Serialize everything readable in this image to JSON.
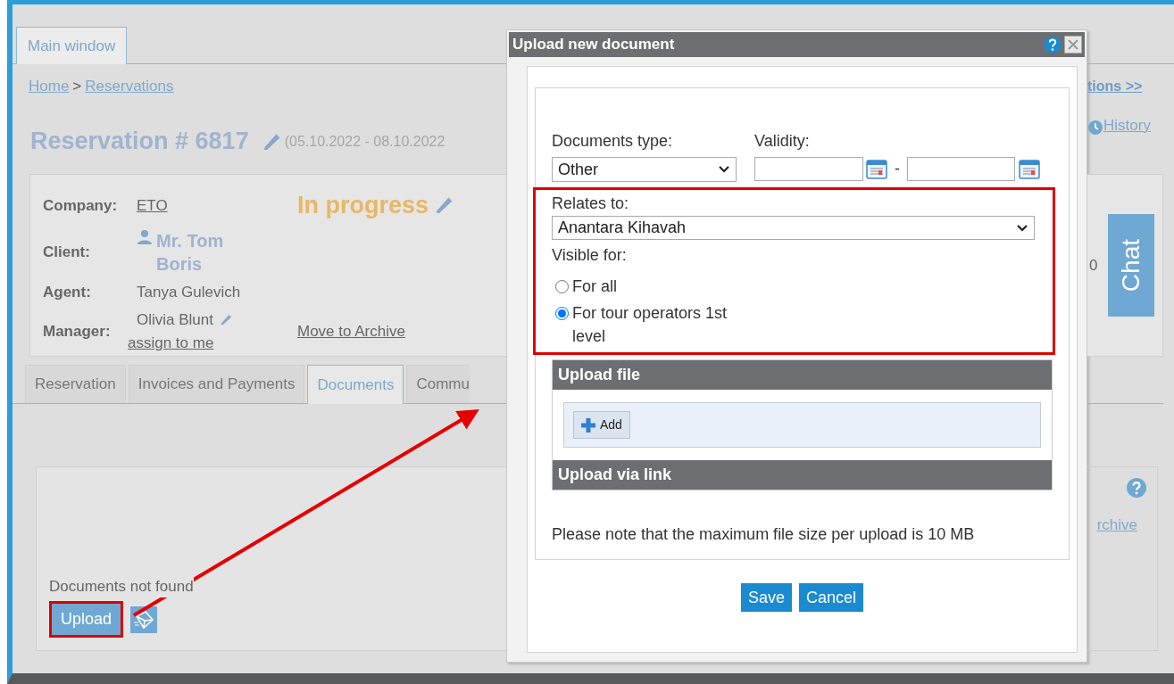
{
  "main_tab": {
    "label": "Main window",
    "selected": true
  },
  "breadcrumb": {
    "items": [
      {
        "label": "Home"
      },
      {
        "label": "Reservations"
      }
    ],
    "separator": ">"
  },
  "reservation": {
    "title": "Reservation # 6817",
    "dates": "(05.10.2022 - 08.10.2022",
    "status": "In progress"
  },
  "details": [
    {
      "label": "Company:",
      "value": "ETO",
      "kind": "link"
    },
    {
      "label": "Client:",
      "value": "Mr. Tom Boris",
      "kind": "person"
    },
    {
      "label": "Agent:",
      "value": "Tanya Gulevich",
      "kind": "text"
    },
    {
      "label": "Manager:",
      "value": "Olivia Blunt",
      "kind": "editable",
      "action": "assign to me"
    }
  ],
  "archive_link": "Move to Archive",
  "tabs": [
    {
      "label": "Reservation",
      "selected": false
    },
    {
      "label": "Invoices and Payments",
      "selected": false
    },
    {
      "label": "Documents",
      "selected": true
    },
    {
      "label": "Commu",
      "selected": false
    }
  ],
  "documents": {
    "empty_text": "Documents not found",
    "upload_button": "Upload"
  },
  "right_edge": {
    "notifications_link": "tions >>",
    "history_link": "History",
    "counter": "0",
    "chat_button": "Chat",
    "archive_link": "rchive"
  },
  "dialog": {
    "title": "Upload new document",
    "document_type": {
      "label": "Documents type:",
      "value": "Other"
    },
    "validity": {
      "label": "Validity:",
      "separator": "-"
    },
    "relates_to": {
      "label": "Relates to:",
      "value": "Anantara Kihavah"
    },
    "visible_for": {
      "label": "Visible for:",
      "options": [
        {
          "label": "For all",
          "selected": false
        },
        {
          "label": "For tour operators 1st level",
          "selected": true
        }
      ]
    },
    "upload_file": {
      "title": "Upload file",
      "add_button": "Add"
    },
    "upload_link": {
      "title": "Upload via link"
    },
    "note": "Please note that the maximum file size per upload is 10 MB",
    "buttons": [
      "Save",
      "Cancel"
    ]
  }
}
